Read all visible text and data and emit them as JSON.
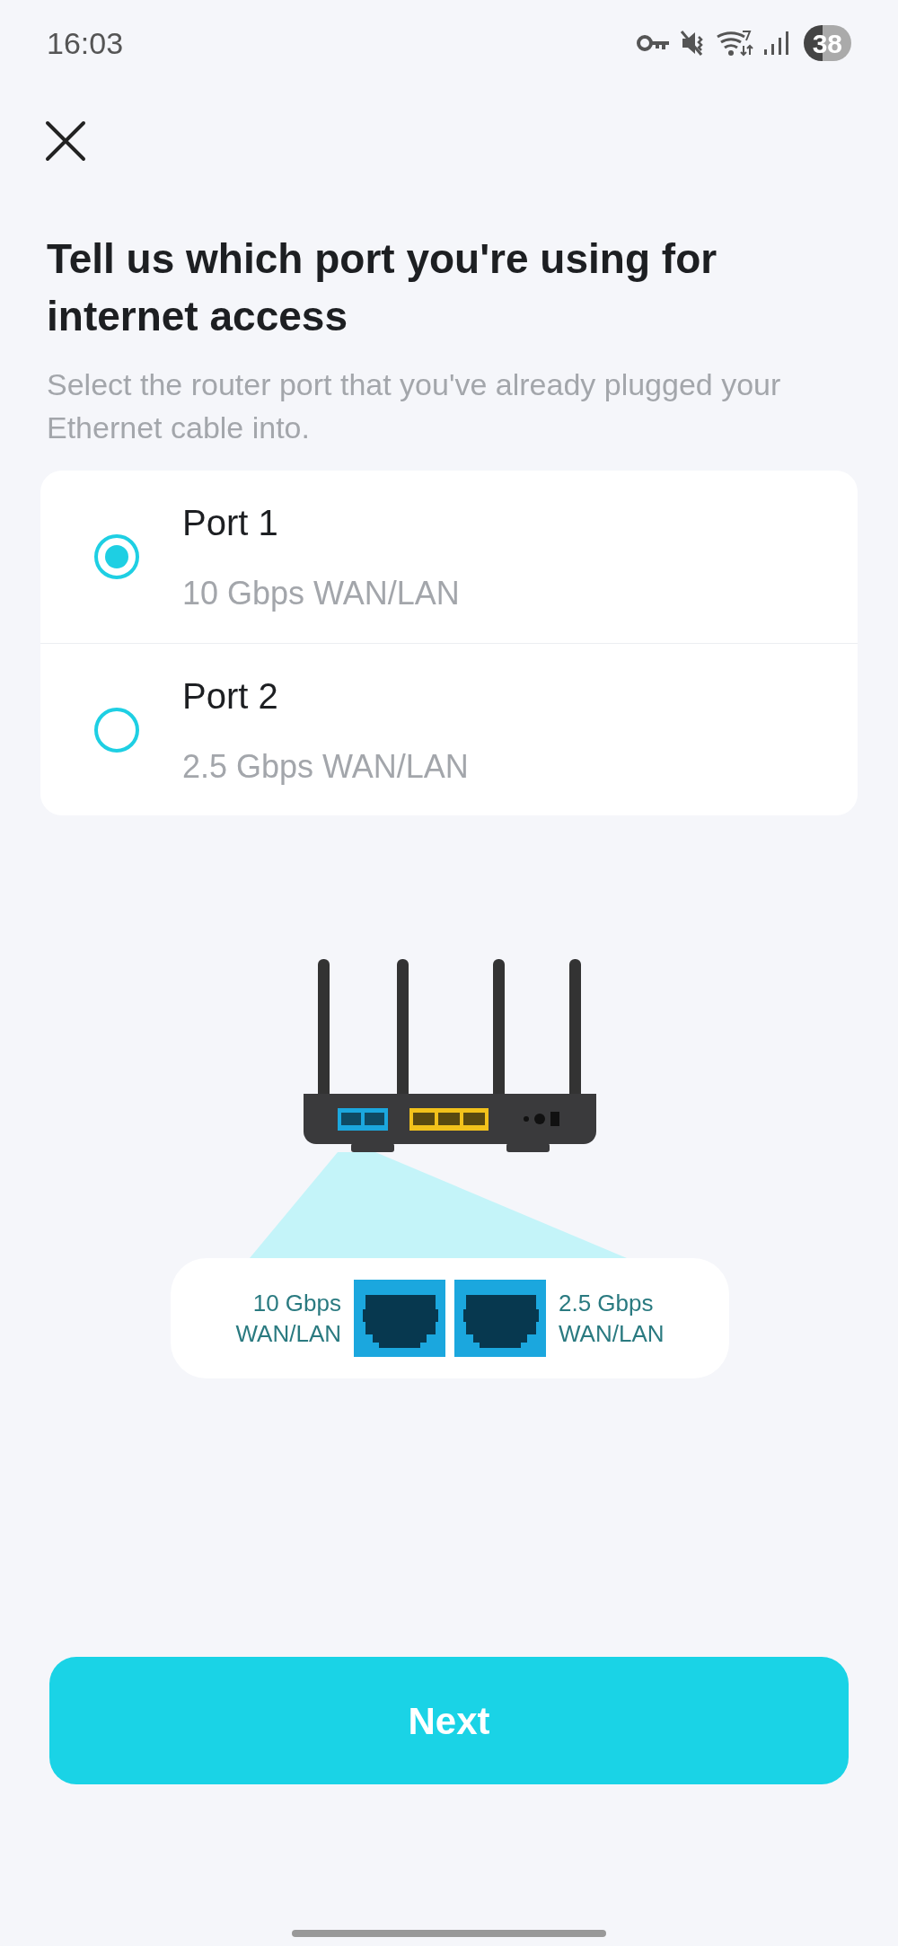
{
  "status_bar": {
    "time": "16:03",
    "battery": "38"
  },
  "title": "Tell us which port you're using for internet access",
  "subtitle": "Select the router port that you've already plugged your Ethernet cable into.",
  "ports": [
    {
      "label": "Port 1",
      "detail": "10 Gbps WAN/LAN",
      "selected": true
    },
    {
      "label": "Port 2",
      "detail": "2.5 Gbps WAN/LAN",
      "selected": false
    }
  ],
  "diagram": {
    "left_label": [
      "10 Gbps",
      "WAN/LAN"
    ],
    "right_label": [
      "2.5 Gbps",
      "WAN/LAN"
    ]
  },
  "next_button": "Next"
}
